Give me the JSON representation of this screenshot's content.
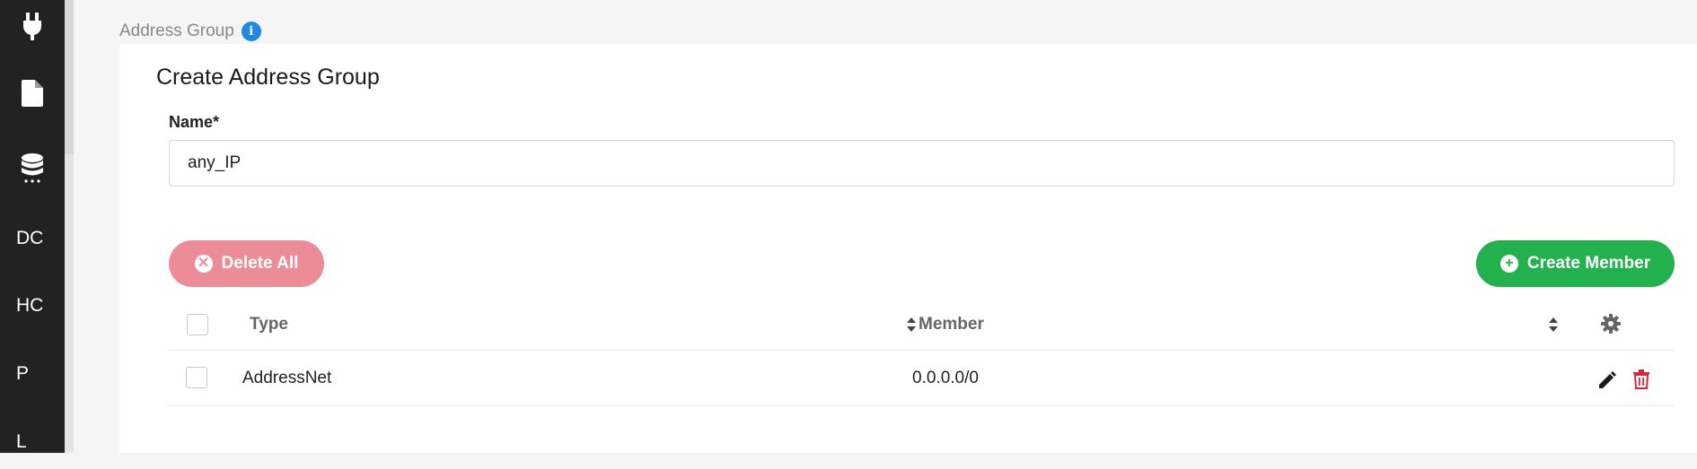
{
  "sidebar": {
    "items": [
      {
        "icon": "plug-icon"
      },
      {
        "icon": "document-icon"
      },
      {
        "icon": "database-icon"
      },
      {
        "label": "DC"
      },
      {
        "label": "HC"
      },
      {
        "label": "P"
      },
      {
        "label": "L"
      }
    ]
  },
  "breadcrumb": {
    "label": "Address Group",
    "info_icon": "info-icon"
  },
  "form": {
    "title": "Create Address Group",
    "name_label": "Name*",
    "name_value": "any_IP"
  },
  "actions": {
    "delete_all_label": "Delete All",
    "create_member_label": "Create Member"
  },
  "table": {
    "columns": [
      "Type",
      "Member"
    ],
    "rows": [
      {
        "type": "AddressNet",
        "member": "0.0.0.0/0"
      }
    ]
  },
  "colors": {
    "sidebar_bg": "#222222",
    "info_blue": "#1e88e5",
    "delete_button": "#eb8c96",
    "create_button": "#22b14c",
    "trash_red": "#d6263a"
  }
}
